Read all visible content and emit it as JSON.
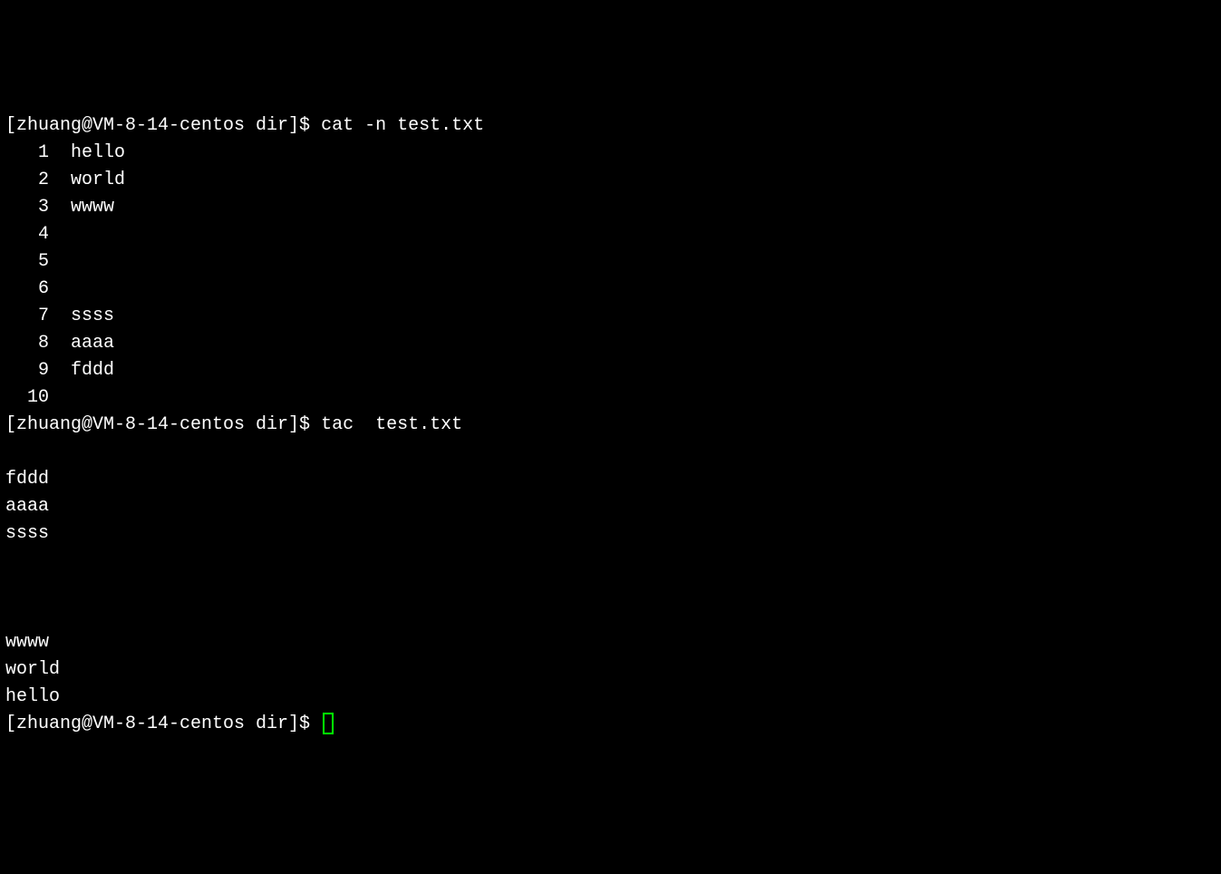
{
  "prompt1": {
    "user_host": "[zhuang@VM-8-14-centos dir]$ ",
    "command": "cat -n test.txt"
  },
  "cat_output": [
    {
      "num": "1",
      "text": "hello"
    },
    {
      "num": "2",
      "text": "world"
    },
    {
      "num": "3",
      "text": "wwww"
    },
    {
      "num": "4",
      "text": ""
    },
    {
      "num": "5",
      "text": ""
    },
    {
      "num": "6",
      "text": ""
    },
    {
      "num": "7",
      "text": "ssss"
    },
    {
      "num": "8",
      "text": "aaaa"
    },
    {
      "num": "9",
      "text": "fddd"
    },
    {
      "num": "10",
      "text": ""
    }
  ],
  "prompt2": {
    "user_host": "[zhuang@VM-8-14-centos dir]$ ",
    "command": "tac  test.txt"
  },
  "tac_output": [
    "",
    "fddd",
    "aaaa",
    "ssss",
    "",
    "",
    "",
    "wwww",
    "world",
    "hello"
  ],
  "prompt3": {
    "user_host": "[zhuang@VM-8-14-centos dir]$ "
  }
}
